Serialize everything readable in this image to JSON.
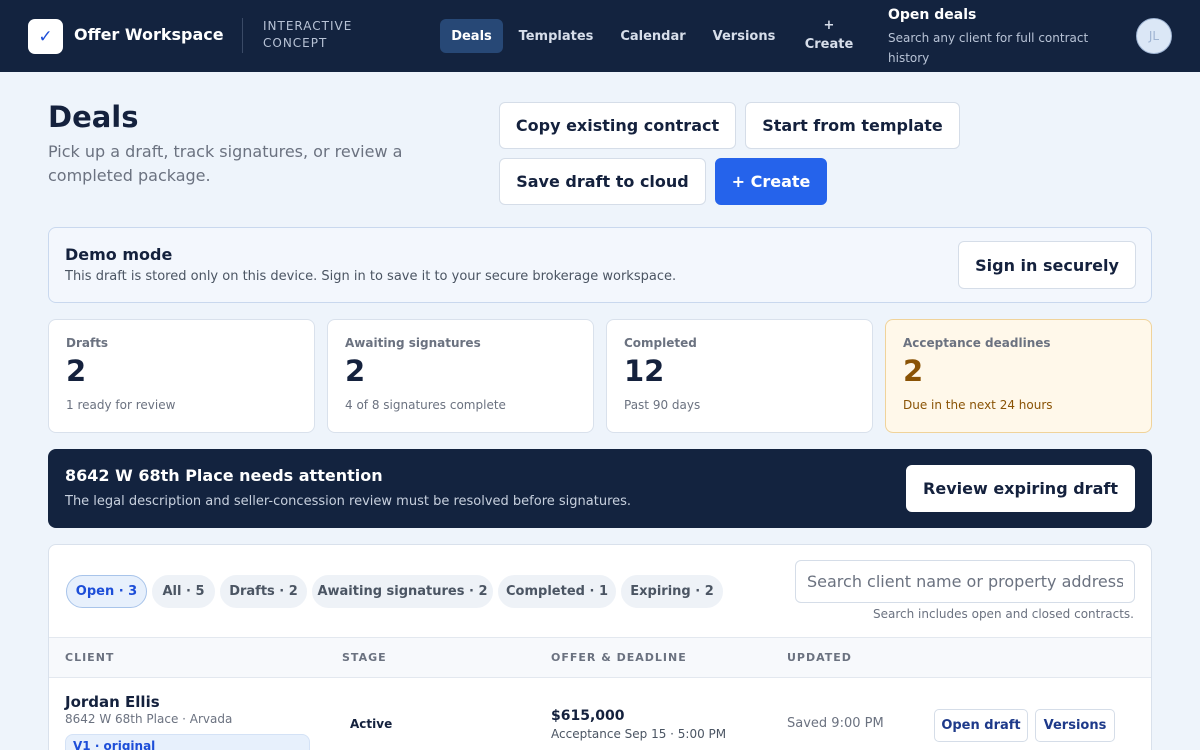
{
  "colors": {
    "nav_background": "#13233f",
    "page_background": "#eef4fb",
    "primary_accent": "#2563eb",
    "warning_card_background": "#fff8ea",
    "warning_text": "#8a5305"
  },
  "topbar": {
    "logo_glyph": "✓",
    "logo_icon": "check-icon",
    "brand": "Offer Workspace",
    "concept_label": "INTERACTIVE CONCEPT",
    "nav": [
      {
        "label": "Deals",
        "active": true
      },
      {
        "label": "Templates",
        "active": false
      },
      {
        "label": "Calendar",
        "active": false
      },
      {
        "label": "Versions",
        "active": false
      }
    ],
    "create_label": "+ Create",
    "open_deals_title": "Open deals",
    "open_deals_subtitle": "Search any client for full contract history",
    "avatar_initials": "JL"
  },
  "header": {
    "title": "Deals",
    "subtitle": "Pick up a draft, track signatures, or review a completed package.",
    "actions": {
      "copy_contract": "Copy existing contract",
      "start_template": "Start from template",
      "save_cloud": "Save draft to cloud",
      "create": "+ Create"
    }
  },
  "demo_banner": {
    "title": "Demo mode",
    "message": "This draft is stored only on this device. Sign in to save it to your secure brokerage workspace.",
    "button": "Sign in securely"
  },
  "stats": [
    {
      "label": "Drafts",
      "value": "2",
      "note": "1 ready for review"
    },
    {
      "label": "Awaiting signatures",
      "value": "2",
      "note": "4 of 8 signatures complete"
    },
    {
      "label": "Completed",
      "value": "12",
      "note": "Past 90 days"
    },
    {
      "label": "Acceptance deadlines",
      "value": "2",
      "note": "Due in the next 24 hours"
    }
  ],
  "attention": {
    "title": "8642 W 68th Place needs attention",
    "message": "The legal description and seller-concession review must be resolved before signatures.",
    "button": "Review expiring draft"
  },
  "deals": {
    "filters": [
      {
        "label": "Open · 3",
        "active": true
      },
      {
        "label": "All · 5",
        "active": false
      },
      {
        "label": "Drafts · 2",
        "active": false
      },
      {
        "label": "Awaiting signatures · 2",
        "active": false
      },
      {
        "label": "Completed · 1",
        "active": false
      },
      {
        "label": "Expiring · 2",
        "active": false
      }
    ],
    "search_placeholder": "Search client name or property address",
    "search_hint": "Search includes open and closed contracts.",
    "columns": [
      "CLIENT",
      "STAGE",
      "OFFER & DEADLINE",
      "UPDATED"
    ],
    "rows": [
      {
        "client": "Jordan Ellis",
        "address": "8642 W 68th Place · Arvada",
        "version": "V1 · original",
        "stage": "Active",
        "offer": "$615,000",
        "deadline": "Acceptance Sep 15 · 5:00 PM",
        "updated": "Saved 9:00 PM",
        "open_button": "Open draft",
        "versions_button": "Versions"
      }
    ]
  }
}
